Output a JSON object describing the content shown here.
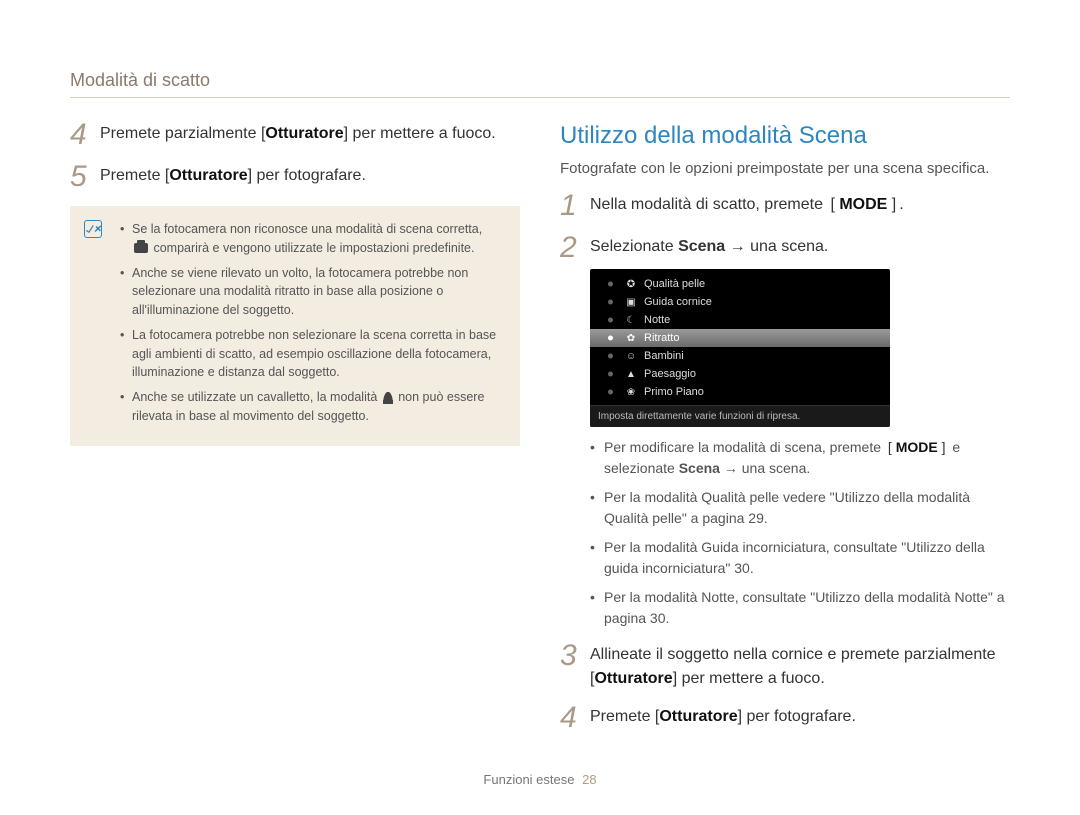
{
  "breadcrumb": "Modalità di scatto",
  "left": {
    "step4_num": "4",
    "step4_pre": "Premete parzialmente [",
    "step4_key": "Otturatore",
    "step4_post": "] per mettere a fuoco.",
    "step5_num": "5",
    "step5_pre": "Premete [",
    "step5_key": "Otturatore",
    "step5_post": "] per fotografare.",
    "notes": {
      "n1a": "Se la fotocamera non riconosce una modalità di scena corretta,",
      "n1b": " comparirà e vengono utilizzate le impostazioni predefinite.",
      "n2": "Anche se viene rilevato un volto, la fotocamera potrebbe non selezionare una modalità ritratto in base alla posizione o all'illuminazione del soggetto.",
      "n3": "La fotocamera potrebbe non selezionare la scena corretta in base agli ambienti di scatto, ad esempio oscillazione della fotocamera, illuminazione e distanza dal soggetto.",
      "n4a": "Anche se utilizzate un cavalletto, la modalità ",
      "n4b": " non può essere rilevata in base al movimento del soggetto."
    }
  },
  "right": {
    "heading": "Utilizzo della modalità Scena",
    "intro": "Fotografate con le opzioni preimpostate per una scena specifica.",
    "step1_num": "1",
    "step1_pre": "Nella modalità di scatto, premete ",
    "step1_key": "MODE",
    "step1_post": ".",
    "step2_num": "2",
    "step2_pre": "Selezionate ",
    "step2_bold": "Scena",
    "step2_post": " → una scena.",
    "scene": {
      "items": [
        {
          "icon": "✪",
          "label": "Qualità pelle"
        },
        {
          "icon": "▣",
          "label": "Guida cornice"
        },
        {
          "icon": "☾",
          "label": "Notte"
        },
        {
          "icon": "✿",
          "label": "Ritratto"
        },
        {
          "icon": "☺",
          "label": "Bambini"
        },
        {
          "icon": "▲",
          "label": "Paesaggio"
        },
        {
          "icon": "❀",
          "label": "Primo Piano"
        }
      ],
      "footer": "Imposta direttamente varie funzioni di ripresa."
    },
    "bullets": {
      "b1_pre": "Per modificare la modalità di scena, premete ",
      "b1_key": "MODE",
      "b1_mid": " e selezionate ",
      "b1_bold": "Scena",
      "b1_post": " → una scena.",
      "b2": "Per la modalità Qualità pelle vedere \"Utilizzo della modalità Qualità pelle\" a pagina 29.",
      "b3": "Per la modalità Guida incorniciatura, consultate \"Utilizzo della guida incorniciatura\" 30.",
      "b4": "Per la modalità Notte, consultate \"Utilizzo della modalità Notte\" a pagina 30."
    },
    "step3_num": "3",
    "step3_pre": "Allineate il soggetto nella cornice e premete parzialmente [",
    "step3_key": "Otturatore",
    "step3_post": "] per mettere a fuoco.",
    "step4_num": "4",
    "step4_pre": "Premete [",
    "step4_key": "Otturatore",
    "step4_post": "] per fotografare."
  },
  "footer": {
    "section": "Funzioni estese",
    "page": "28"
  }
}
